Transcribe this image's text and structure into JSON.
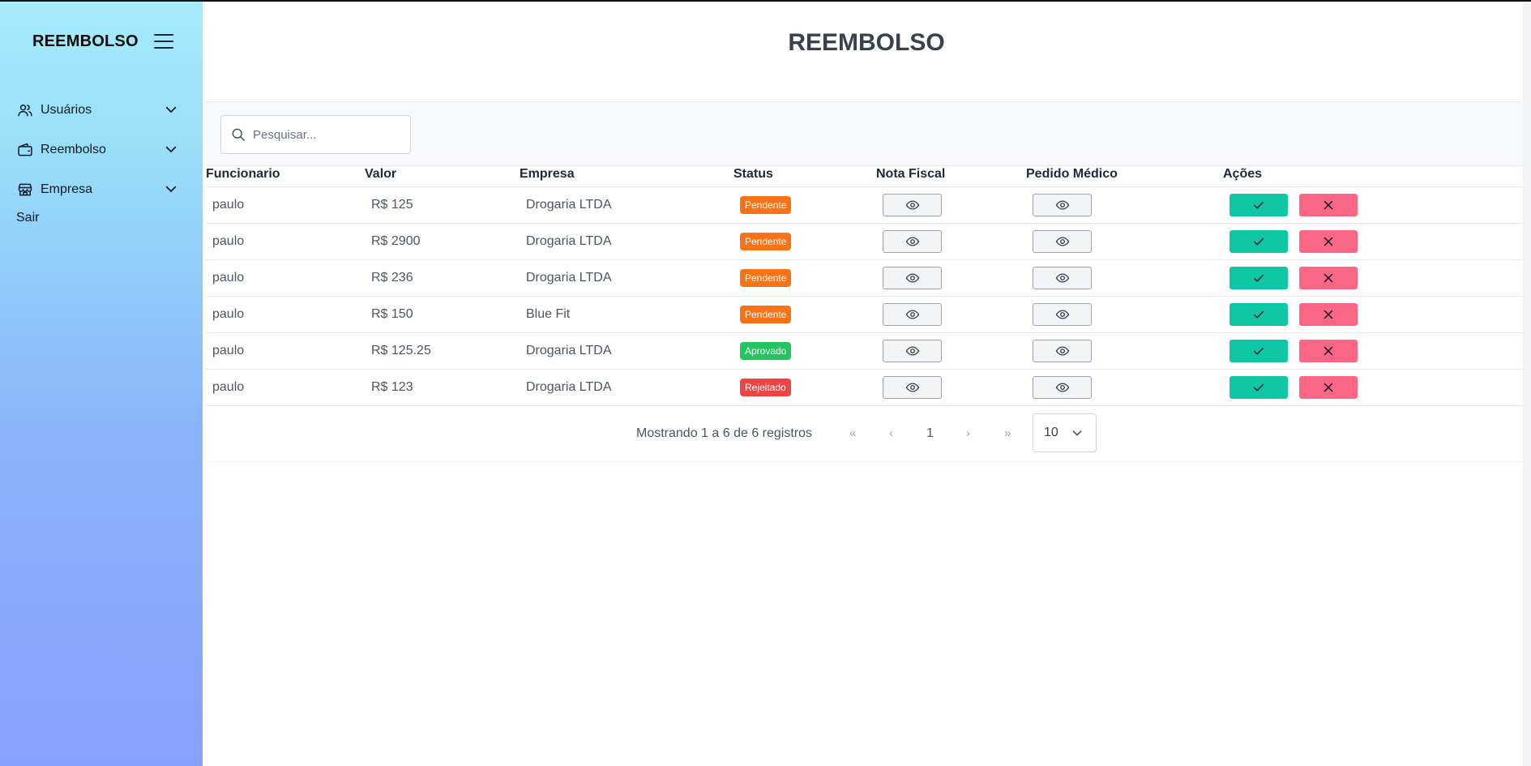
{
  "sidebar": {
    "brand": "REEMBOLSO",
    "items": [
      {
        "label": "Usuários",
        "icon": "users-icon"
      },
      {
        "label": "Reembolso",
        "icon": "wallet-icon"
      },
      {
        "label": "Empresa",
        "icon": "store-icon"
      }
    ],
    "logout": "Sair",
    "gradient_colors": [
      "#a5ecfc",
      "#86a1fd"
    ]
  },
  "main": {
    "title": "REEMBOLSO",
    "search": {
      "placeholder": "Pesquisar...",
      "value": ""
    }
  },
  "table": {
    "headers": [
      "Funcionario",
      "Valor",
      "Empresa",
      "Status",
      "Nota Fiscal",
      "Pedido Médico",
      "Ações"
    ],
    "rows": [
      {
        "funcionario": "paulo",
        "valor": "R$ 125",
        "empresa": "Drogaria LTDA",
        "status": "Pendente"
      },
      {
        "funcionario": "paulo",
        "valor": "R$ 2900",
        "empresa": "Drogaria LTDA",
        "status": "Pendente"
      },
      {
        "funcionario": "paulo",
        "valor": "R$ 236",
        "empresa": "Drogaria LTDA",
        "status": "Pendente"
      },
      {
        "funcionario": "paulo",
        "valor": "R$ 150",
        "empresa": "Blue Fit",
        "status": "Pendente"
      },
      {
        "funcionario": "paulo",
        "valor": "R$ 125.25",
        "empresa": "Drogaria LTDA",
        "status": "Aprovado"
      },
      {
        "funcionario": "paulo",
        "valor": "R$ 123",
        "empresa": "Drogaria LTDA",
        "status": "Rejeitado"
      }
    ]
  },
  "pagination": {
    "info": "Mostrando 1 a 6 de 6 registros",
    "first": "«",
    "prev": "‹",
    "current": "1",
    "next": "›",
    "last": "»",
    "per_page": "10"
  },
  "colors": {
    "pendente": "#f97316",
    "aprovado": "#22c55e",
    "rejeitado": "#ef4444",
    "approve_button": "#10c7a5",
    "reject_button": "#fb6685"
  }
}
